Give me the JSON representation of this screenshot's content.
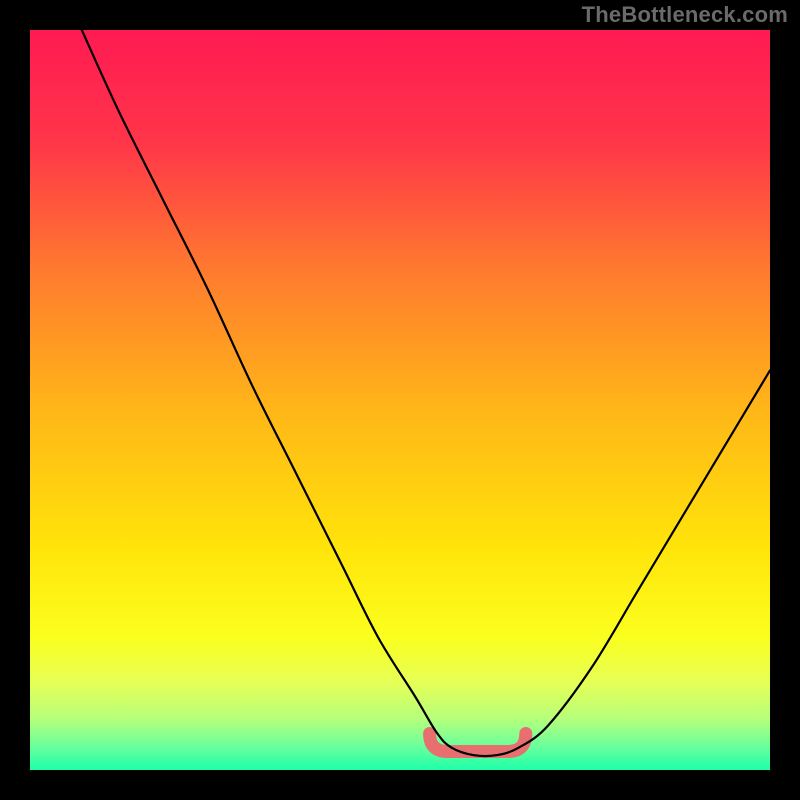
{
  "watermark": "TheBottleneck.com",
  "gradient": {
    "stops": [
      {
        "offset": 0.0,
        "color": "#ff1a52"
      },
      {
        "offset": 0.15,
        "color": "#ff3549"
      },
      {
        "offset": 0.33,
        "color": "#ff7c2e"
      },
      {
        "offset": 0.52,
        "color": "#ffb817"
      },
      {
        "offset": 0.7,
        "color": "#ffe40a"
      },
      {
        "offset": 0.82,
        "color": "#fbff1e"
      },
      {
        "offset": 0.88,
        "color": "#e7ff55"
      },
      {
        "offset": 0.93,
        "color": "#b7ff7a"
      },
      {
        "offset": 0.97,
        "color": "#66ff9d"
      },
      {
        "offset": 1.0,
        "color": "#1dffa8"
      }
    ]
  },
  "chart_data": {
    "type": "line",
    "title": "",
    "xlabel": "",
    "ylabel": "",
    "xlim": [
      0,
      100
    ],
    "ylim": [
      0,
      100
    ],
    "grid": false,
    "series": [
      {
        "name": "bottleneck-curve",
        "x": [
          7,
          12,
          18,
          24,
          30,
          36,
          42,
          47,
          52,
          55,
          57,
          60,
          63,
          66,
          70,
          76,
          82,
          88,
          94,
          100
        ],
        "values": [
          100,
          89,
          77,
          65,
          52,
          40,
          28,
          18,
          10,
          5,
          3,
          2,
          2,
          3,
          6,
          14,
          24,
          34,
          44,
          54
        ]
      }
    ],
    "valley": {
      "x_start": 54,
      "x_end": 67,
      "y": 2.5
    }
  }
}
